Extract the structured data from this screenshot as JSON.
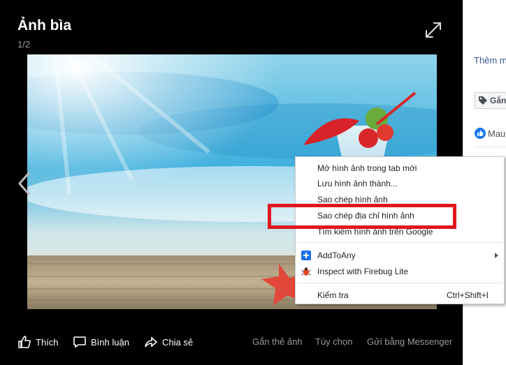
{
  "viewer": {
    "title": "Ảnh bìa",
    "counter": "1/2"
  },
  "actions": {
    "like": "Thích",
    "comment": "Bình luận",
    "share": "Chia sẻ",
    "tag_photo": "Gắn thẻ ảnh",
    "options": "Tùy chọn",
    "send_messenger": "Gửi bằng Messenger"
  },
  "side": {
    "link": "Thêm m",
    "tag": "Gắn",
    "like": "Mau"
  },
  "context_menu": {
    "items": [
      {
        "label": "Mở hình ảnh trong tab mới"
      },
      {
        "label": "Lưu hình ảnh thành..."
      },
      {
        "label": "Sao chép hình ảnh"
      },
      {
        "label": "Sao chép địa chỉ hình ảnh"
      },
      {
        "label": "Tìm kiếm hình ảnh trên Google"
      },
      {
        "label": "AddToAny",
        "icon": "addtoany-icon"
      },
      {
        "label": "Inspect with Firebug Lite",
        "icon": "firebug-icon"
      },
      {
        "label": "Kiểm tra",
        "shortcut": "Ctrl+Shift+I"
      }
    ],
    "highlighted_item": "Sao chép địa chỉ hình ảnh"
  },
  "colors": {
    "viewer_bg": "#000000",
    "highlight_border": "#e0161e",
    "link": "#385898"
  }
}
